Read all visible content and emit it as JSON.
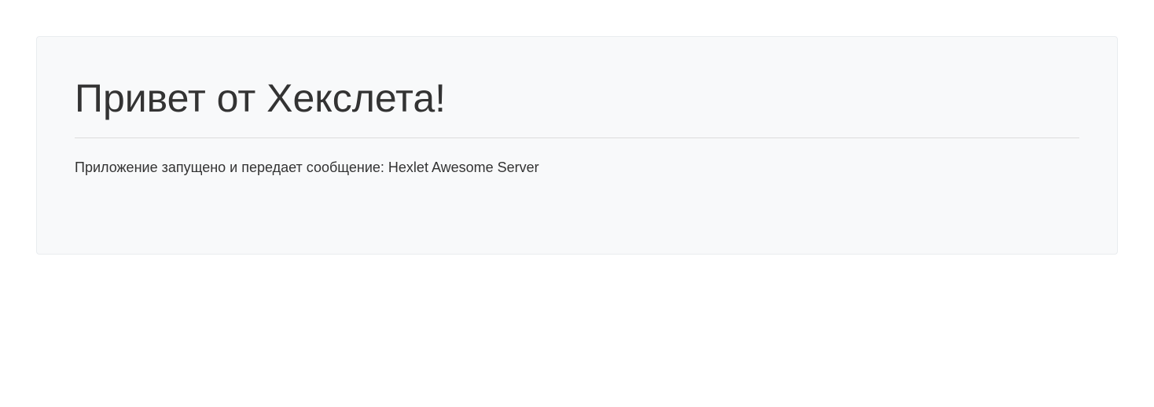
{
  "hero": {
    "heading": "Привет от Хекслета!",
    "message": "Приложение запущено и передает сообщение: Hexlet Awesome Server"
  }
}
